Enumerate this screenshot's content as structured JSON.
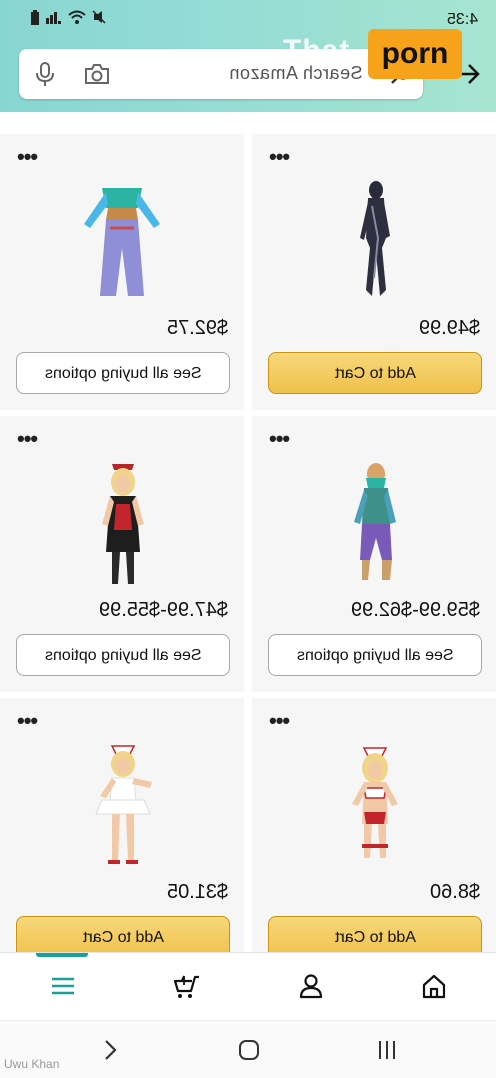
{
  "status": {
    "time": "4:35",
    "icons": [
      "battery-icon",
      "signal-icon",
      "wifi-icon",
      "mute-icon"
    ]
  },
  "search": {
    "placeholder": "Search Amazon"
  },
  "watermark": {
    "text": "That",
    "badge": "porn"
  },
  "products": [
    {
      "price": "$49.99",
      "button": "Add to Cart",
      "button_type": "add"
    },
    {
      "price": "$92.75",
      "button": "See all buying options",
      "button_type": "see"
    },
    {
      "price": "$59.99-$62.99",
      "button": "See all buying options",
      "button_type": "see"
    },
    {
      "price": "$47.99-$55.99",
      "button": "See all buying options",
      "button_type": "see"
    },
    {
      "price": "$8.60",
      "button": "Add to Cart",
      "button_type": "add"
    },
    {
      "price": "$31.05",
      "button": "Add to Cart",
      "button_type": "add"
    }
  ],
  "tabs": [
    "home-icon",
    "account-icon",
    "cart-icon",
    "menu-icon"
  ],
  "nav": [
    "recent-apps-icon",
    "home-button-icon",
    "back-icon"
  ],
  "footer": {
    "user": "Uwu Khan"
  },
  "colors": {
    "accent": "#1aa097",
    "add_button": "#f0c14b",
    "header": "#95dcd5"
  }
}
